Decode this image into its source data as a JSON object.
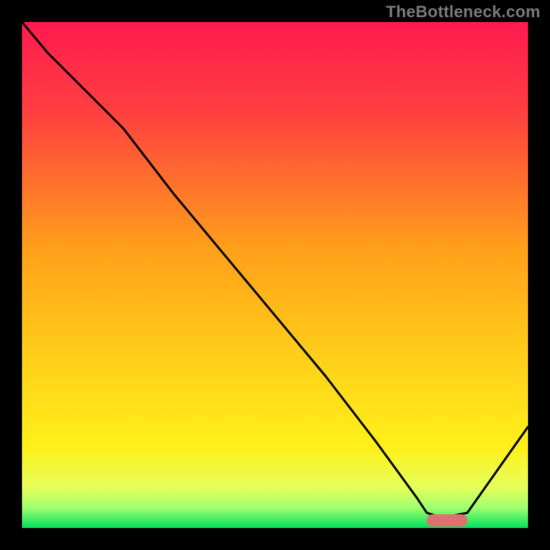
{
  "watermark": "TheBottleneck.com",
  "chart_data": {
    "type": "line",
    "title": "",
    "xlabel": "",
    "ylabel": "",
    "xlim": [
      0,
      100
    ],
    "ylim": [
      0,
      100
    ],
    "grid": false,
    "legend": false,
    "background_gradient": {
      "top_color": "#ff1a4f",
      "mid_color": "#ffcf1a",
      "lower_color": "#ccff44",
      "bottom_color": "#00e05c"
    },
    "series": [
      {
        "name": "bottleneck-curve",
        "color": "#000000",
        "x": [
          0,
          5,
          12,
          20,
          30,
          40,
          50,
          60,
          70,
          78,
          80,
          83,
          88,
          100
        ],
        "y": [
          100,
          94,
          87,
          79,
          66,
          54,
          42,
          30,
          17,
          6,
          3,
          2,
          3,
          20
        ]
      }
    ],
    "marker": {
      "name": "optimal-zone",
      "color": "#e0706f",
      "x_start": 80,
      "x_end": 88,
      "y": 1.5,
      "thickness": 2.4
    }
  }
}
